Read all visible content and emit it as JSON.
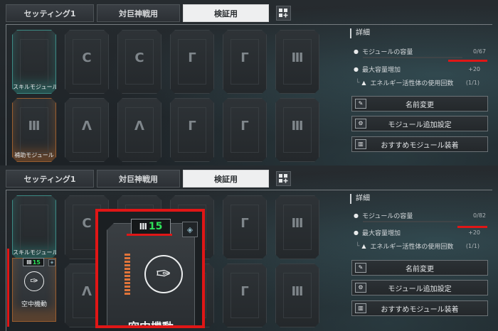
{
  "tabs": [
    "セッティング1",
    "対巨神戦用",
    "検証用"
  ],
  "tab_add_icon": "add-grid-icon",
  "slots_top": [
    {
      "glyph": "",
      "caption": "スキルモジュール",
      "type": "skill"
    },
    {
      "glyph": "C",
      "caption": "",
      "type": "normal"
    },
    {
      "glyph": "C",
      "caption": "",
      "type": "normal"
    },
    {
      "glyph": "Γ",
      "caption": "",
      "type": "normal"
    },
    {
      "glyph": "Γ",
      "caption": "",
      "type": "normal"
    },
    {
      "glyph": "Ⅲ",
      "caption": "",
      "type": "normal"
    },
    {
      "glyph": "Ⅲ",
      "caption": "補助モジュール",
      "type": "aux"
    },
    {
      "glyph": "Λ",
      "caption": "",
      "type": "normal"
    },
    {
      "glyph": "Λ",
      "caption": "",
      "type": "normal"
    },
    {
      "glyph": "Γ",
      "caption": "",
      "type": "normal"
    },
    {
      "glyph": "Γ",
      "caption": "",
      "type": "normal"
    },
    {
      "glyph": "Ⅲ",
      "caption": "",
      "type": "normal"
    }
  ],
  "slots_bottom": [
    {
      "glyph": "",
      "caption": "スキルモジュール",
      "type": "skill"
    },
    {
      "glyph": "C",
      "caption": "",
      "type": "normal"
    },
    {
      "glyph": "",
      "caption": "",
      "type": "normal"
    },
    {
      "glyph": "",
      "caption": "",
      "type": "normal"
    },
    {
      "glyph": "Γ",
      "caption": "",
      "type": "normal"
    },
    {
      "glyph": "Ⅲ",
      "caption": "",
      "type": "normal"
    },
    {
      "glyph": "",
      "caption": "",
      "type": "hidden"
    },
    {
      "glyph": "Λ",
      "caption": "",
      "type": "normal"
    },
    {
      "glyph": "",
      "caption": "",
      "type": "normal"
    },
    {
      "glyph": "",
      "caption": "",
      "type": "normal"
    },
    {
      "glyph": "Γ",
      "caption": "",
      "type": "normal"
    },
    {
      "glyph": "Ⅲ",
      "caption": "",
      "type": "normal"
    }
  ],
  "detail": {
    "title": "詳細",
    "capacity_label": "モジュールの容量",
    "capacity_top": "0/67",
    "capacity_bottom": "0/82",
    "max_increase_label": "最大容量増加",
    "max_increase_value": "+20",
    "energy_label": "エネルギー活性体の使用回数",
    "energy_value": "(1/1)"
  },
  "actions": [
    "名前変更",
    "モジュール追加設定",
    "おすすめモジュール装着"
  ],
  "equipped_module": {
    "name": "空中機動",
    "cost": "15",
    "tier_glyph": "Ⅲ"
  },
  "colors": {
    "accent_red": "#e01616",
    "cost_green": "#2ee35a",
    "skill_teal": "#3c8a84",
    "aux_orange": "#9a5e2f"
  }
}
